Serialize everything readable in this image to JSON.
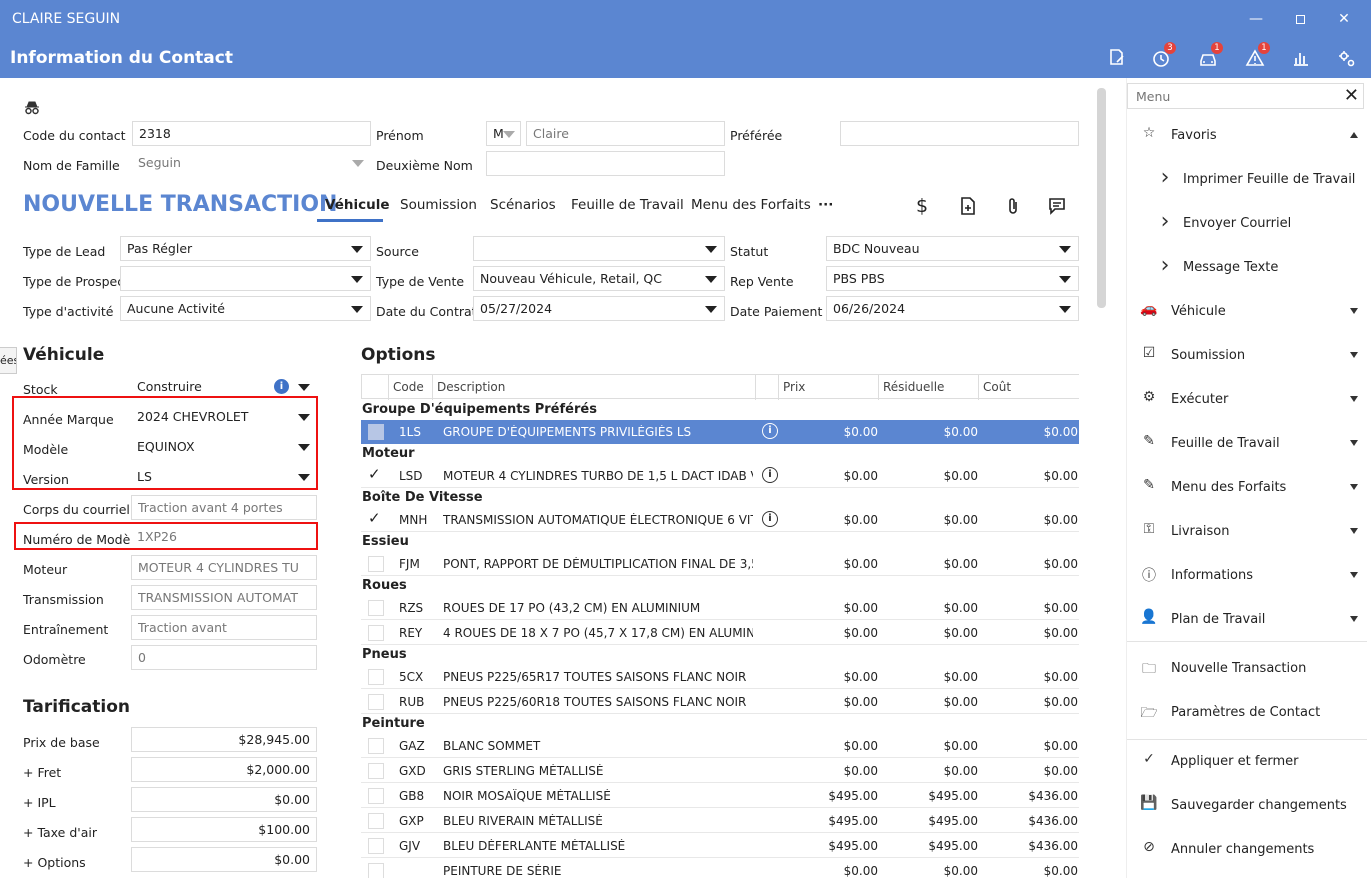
{
  "window": {
    "title": "CLAIRE SEGUIN"
  },
  "header": {
    "title": "Information du Contact",
    "badges": {
      "history": "3",
      "vehicle": "1",
      "alert": "1"
    }
  },
  "contact": {
    "code_label": "Code du contact",
    "code_value": "2318",
    "prenom_label": "Prénom",
    "prenom_title": "M",
    "prenom_value": "Claire",
    "preferee_label": "Préférée",
    "preferee_value": "",
    "nom_label": "Nom de Famille",
    "nom_value": "Seguin",
    "deuxieme_label": "Deuxième Nom",
    "deuxieme_value": ""
  },
  "transaction": {
    "title": "NOUVELLE TRANSACTION",
    "tabs": [
      "Véhicule",
      "Soumission",
      "Scénarios",
      "Feuille de Travail",
      "Menu des Forfaits",
      "···"
    ],
    "fields": {
      "type_lead_label": "Type de Lead",
      "type_lead_value": "Pas Régler",
      "source_label": "Source",
      "source_value": "",
      "statut_label": "Statut",
      "statut_value": "BDC Nouveau",
      "type_prospect_label": "Type de Prospect",
      "type_prospect_value": "",
      "type_vente_label": "Type de Vente",
      "type_vente_value": "Nouveau Véhicule, Retail, QC",
      "rep_vente_label": "Rep Vente",
      "rep_vente_value": "PBS PBS",
      "type_activite_label": "Type d'activité",
      "type_activite_value": "Aucune Activité",
      "date_contrat_label": "Date du Contrat",
      "date_contrat_value": "05/27/2024",
      "date_paiement_label": "Date Paiement",
      "date_paiement_value": "06/26/2024"
    }
  },
  "side_tab": "ées",
  "vehicule": {
    "title": "Véhicule",
    "stock_label": "Stock",
    "stock_value": "Construire",
    "annee_label": "Année Marque",
    "annee_value": "2024 CHEVROLET",
    "modele_label": "Modèle",
    "modele_value": "EQUINOX",
    "version_label": "Version",
    "version_value": "LS",
    "corps_label": "Corps du courriel",
    "corps_value": "Traction avant 4 portes",
    "numero_label": "Numéro de Modèle",
    "numero_value": "1XP26",
    "moteur_label": "Moteur",
    "moteur_value": "MOTEUR 4 CYLINDRES TU",
    "transmission_label": "Transmission",
    "transmission_value": "TRANSMISSION AUTOMAT",
    "entrainement_label": "Entraînement",
    "entrainement_value": "Traction avant",
    "odometre_label": "Odomètre",
    "odometre_value": "0"
  },
  "tarification": {
    "title": "Tarification",
    "prix_base_label": "Prix de base",
    "prix_base_value": "$28,945.00",
    "fret_label": "+ Fret",
    "fret_value": "$2,000.00",
    "ipl_label": "+ IPL",
    "ipl_value": "$0.00",
    "taxe_label": "+ Taxe d'air",
    "taxe_value": "$100.00",
    "options_label": "+ Options",
    "options_value": "$0.00"
  },
  "options": {
    "title": "Options",
    "headers": {
      "code": "Code",
      "description": "Description",
      "prix": "Prix",
      "residuelle": "Résiduelle",
      "cout": "Coût"
    },
    "groups": [
      {
        "name": "Groupe D'équipements Préférés",
        "rows": [
          {
            "code": "1LS",
            "desc": "GROUPE D'ÉQUIPEMENTS PRIVILÉGIÉS LS",
            "prix": "$0.00",
            "res": "$0.00",
            "cout": "$0.00",
            "selected": true,
            "checked": false,
            "info": true
          }
        ]
      },
      {
        "name": "Moteur",
        "rows": [
          {
            "code": "LSD",
            "desc": "MOTEUR 4 CYLINDRES TURBO DE 1,5 L DACT IDAB VVT",
            "prix": "$0.00",
            "res": "$0.00",
            "cout": "$0.00",
            "checked": true,
            "info": true
          }
        ]
      },
      {
        "name": "Boîte De Vitesse",
        "rows": [
          {
            "code": "MNH",
            "desc": "TRANSMISSION AUTOMATIQUE ÉLECTRONIQUE 6 VITES...",
            "prix": "$0.00",
            "res": "$0.00",
            "cout": "$0.00",
            "checked": true,
            "info": true
          }
        ]
      },
      {
        "name": "Essieu",
        "rows": [
          {
            "code": "FJM",
            "desc": "PONT, RAPPORT DE DÉMULTIPLICATION FINAL DE 3,50",
            "prix": "$0.00",
            "res": "$0.00",
            "cout": "$0.00"
          }
        ]
      },
      {
        "name": "Roues",
        "rows": [
          {
            "code": "RZS",
            "desc": "ROUES DE 17 PO (43,2 CM) EN ALUMINIUM",
            "prix": "$0.00",
            "res": "$0.00",
            "cout": "$0.00"
          },
          {
            "code": "REY",
            "desc": "4 ROUES DE 18 X 7 PO (45,7 X 17,8 CM) EN ALUMINIUM",
            "prix": "$0.00",
            "res": "$0.00",
            "cout": "$0.00"
          }
        ]
      },
      {
        "name": "Pneus",
        "rows": [
          {
            "code": "5CX",
            "desc": "PNEUS P225/65R17 TOUTES SAISONS FLANC NOIR",
            "prix": "$0.00",
            "res": "$0.00",
            "cout": "$0.00"
          },
          {
            "code": "RUB",
            "desc": "PNEUS P225/60R18 TOUTES SAISONS FLANC NOIR",
            "prix": "$0.00",
            "res": "$0.00",
            "cout": "$0.00"
          }
        ]
      },
      {
        "name": "Peinture",
        "rows": [
          {
            "code": "GAZ",
            "desc": "BLANC SOMMET",
            "prix": "$0.00",
            "res": "$0.00",
            "cout": "$0.00"
          },
          {
            "code": "GXD",
            "desc": "GRIS STERLING MÉTALLISÉ",
            "prix": "$0.00",
            "res": "$0.00",
            "cout": "$0.00"
          },
          {
            "code": "GB8",
            "desc": "NOIR MOSAÏQUE MÉTALLISÉ",
            "prix": "$495.00",
            "res": "$495.00",
            "cout": "$436.00"
          },
          {
            "code": "GXP",
            "desc": "BLEU RIVERAIN MÉTALLISÉ",
            "prix": "$495.00",
            "res": "$495.00",
            "cout": "$436.00"
          },
          {
            "code": "GJV",
            "desc": "BLEU DÉFERLANTE MÉTALLISÉ",
            "prix": "$495.00",
            "res": "$495.00",
            "cout": "$436.00"
          },
          {
            "code": "",
            "desc": "PEINTURE DE SÉRIE",
            "prix": "$0.00",
            "res": "$0.00",
            "cout": "$0.00"
          }
        ]
      }
    ]
  },
  "menu": {
    "search_placeholder": "Menu",
    "items": [
      {
        "label": "Favoris",
        "icon": "star-icon",
        "glyph": "☆",
        "arrow": "up"
      },
      {
        "label": "Imprimer Feuille de Travail",
        "icon": "chevron-right-icon",
        "glyph": "›",
        "sub": true
      },
      {
        "label": "Envoyer Courriel",
        "icon": "chevron-right-icon",
        "glyph": "›",
        "sub": true
      },
      {
        "label": "Message Texte",
        "icon": "chevron-right-icon",
        "glyph": "›",
        "sub": true
      },
      {
        "label": "Véhicule",
        "icon": "car-icon",
        "glyph": "🚗",
        "arrow": "down"
      },
      {
        "label": "Soumission",
        "icon": "checklist-icon",
        "glyph": "☑",
        "arrow": "down"
      },
      {
        "label": "Exécuter",
        "icon": "gears-icon",
        "glyph": "⚙",
        "arrow": "down"
      },
      {
        "label": "Feuille de Travail",
        "icon": "pencil-icon",
        "glyph": "✎",
        "arrow": "down"
      },
      {
        "label": "Menu des Forfaits",
        "icon": "pencil-icon",
        "glyph": "✎",
        "arrow": "down"
      },
      {
        "label": "Livraison",
        "icon": "key-icon",
        "glyph": "⚿",
        "arrow": "down"
      },
      {
        "label": "Informations",
        "icon": "info-icon",
        "glyph": "ⓘ",
        "arrow": "down"
      },
      {
        "label": "Plan de Travail",
        "icon": "person-icon",
        "glyph": "👤",
        "arrow": "down"
      },
      {
        "label": "Nouvelle Transaction",
        "icon": "folder-icon",
        "glyph": "🗀"
      },
      {
        "label": "Paramètres de Contact",
        "icon": "folder-open-icon",
        "glyph": "🗁"
      },
      {
        "label": "Appliquer et fermer",
        "icon": "check-icon",
        "glyph": "✓"
      },
      {
        "label": "Sauvegarder changements",
        "icon": "save-icon",
        "glyph": "💾"
      },
      {
        "label": "Annuler changements",
        "icon": "cancel-icon",
        "glyph": "⊘"
      }
    ]
  }
}
